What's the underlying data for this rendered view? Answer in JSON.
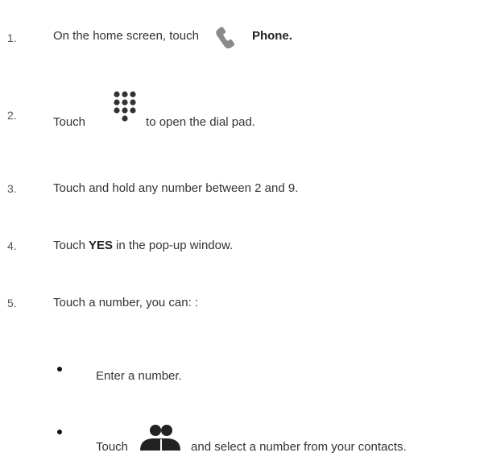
{
  "steps": [
    {
      "number": "1.",
      "before": "On the home screen, touch",
      "icon": "phone-icon",
      "after": "Phone."
    },
    {
      "number": "2.",
      "before": "Touch",
      "icon": "dialpad-icon",
      "after": "to open the dial pad."
    },
    {
      "number": "3.",
      "text": "Touch and hold any number between 2 and 9."
    },
    {
      "number": "4.",
      "before": "Touch",
      "bold": "YES",
      "after": "in the pop-up window."
    },
    {
      "number": "5.",
      "text": "Touch a number, you can: :"
    }
  ],
  "bullets": [
    {
      "text": "Enter a number."
    },
    {
      "before": "Touch",
      "icon": "contacts-icon",
      "after": "and select a number from your contacts."
    }
  ],
  "colors": {
    "text": "#333333",
    "icon": "#8a8a8a"
  }
}
